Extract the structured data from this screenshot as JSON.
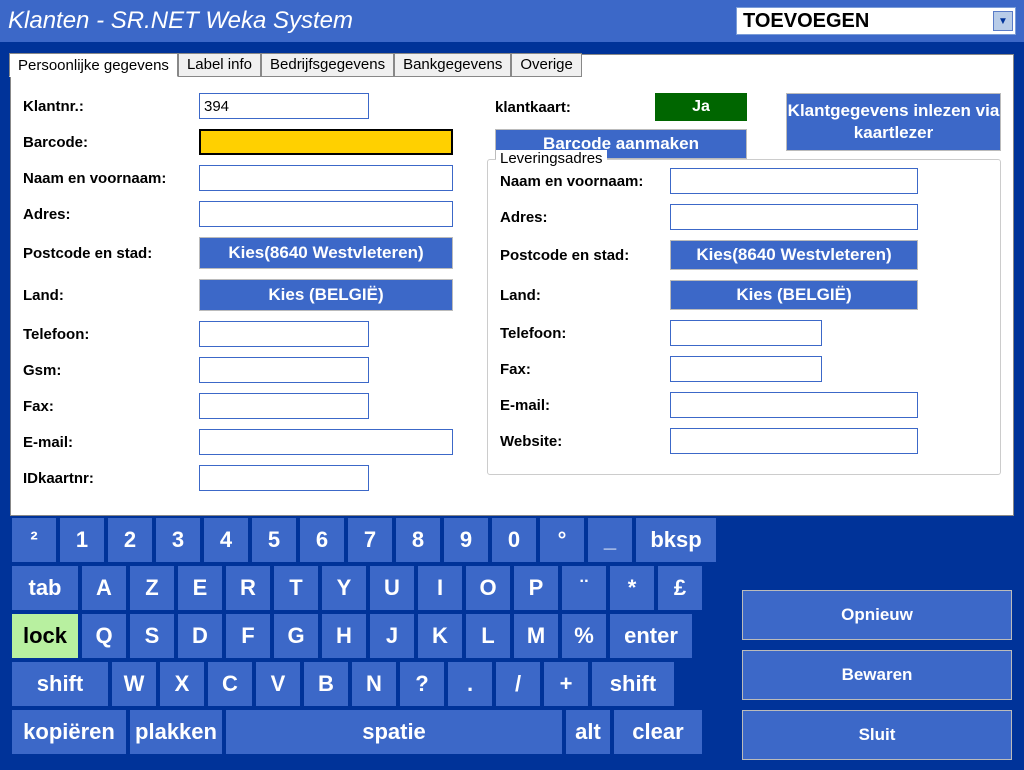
{
  "title": "Klanten - SR.NET Weka System",
  "modeSelected": "TOEVOEGEN",
  "tabs": [
    "Persoonlijke gegevens",
    "Label info",
    "Bedrijfsgegevens",
    "Bankgegevens",
    "Overige"
  ],
  "activeTab": 0,
  "labels": {
    "klantnr": "Klantnr.:",
    "barcode": "Barcode:",
    "naam": "Naam en voornaam:",
    "adres": "Adres:",
    "postcode": "Postcode en stad:",
    "land": "Land:",
    "telefoon": "Telefoon:",
    "gsm": "Gsm:",
    "fax": "Fax:",
    "email": "E-mail:",
    "idkaart": "IDkaartnr:",
    "klantkaart": "klantkaart:",
    "website": "Website:",
    "leveringsadres": "Leveringsadres"
  },
  "values": {
    "klantnr": "394",
    "barcode": "",
    "klantkaart_ja": "Ja"
  },
  "buttons": {
    "barcodeAanmaken": "Barcode aanmaken",
    "klantgegevens": "Klantgegevens inlezen via kaartlezer",
    "kiesPostcode": "Kies(8640 Westvleteren)",
    "kiesLand": "Kies (BELGIË)",
    "opnieuw": "Opnieuw",
    "bewaren": "Bewaren",
    "sluit": "Sluit"
  },
  "keyboard": {
    "r1": [
      "²",
      "1",
      "2",
      "3",
      "4",
      "5",
      "6",
      "7",
      "8",
      "9",
      "0",
      "°",
      "_",
      "bksp"
    ],
    "r2": [
      "tab",
      "A",
      "Z",
      "E",
      "R",
      "T",
      "Y",
      "U",
      "I",
      "O",
      "P",
      "¨",
      "*",
      "£"
    ],
    "r3": [
      "lock",
      "Q",
      "S",
      "D",
      "F",
      "G",
      "H",
      "J",
      "K",
      "L",
      "M",
      "%",
      "enter"
    ],
    "r4": [
      "shift",
      "W",
      "X",
      "C",
      "V",
      "B",
      "N",
      "?",
      ".",
      "/",
      "+",
      "shift"
    ],
    "r5": [
      "kopiëren",
      "plakken",
      "spatie",
      "alt",
      "clear"
    ]
  }
}
